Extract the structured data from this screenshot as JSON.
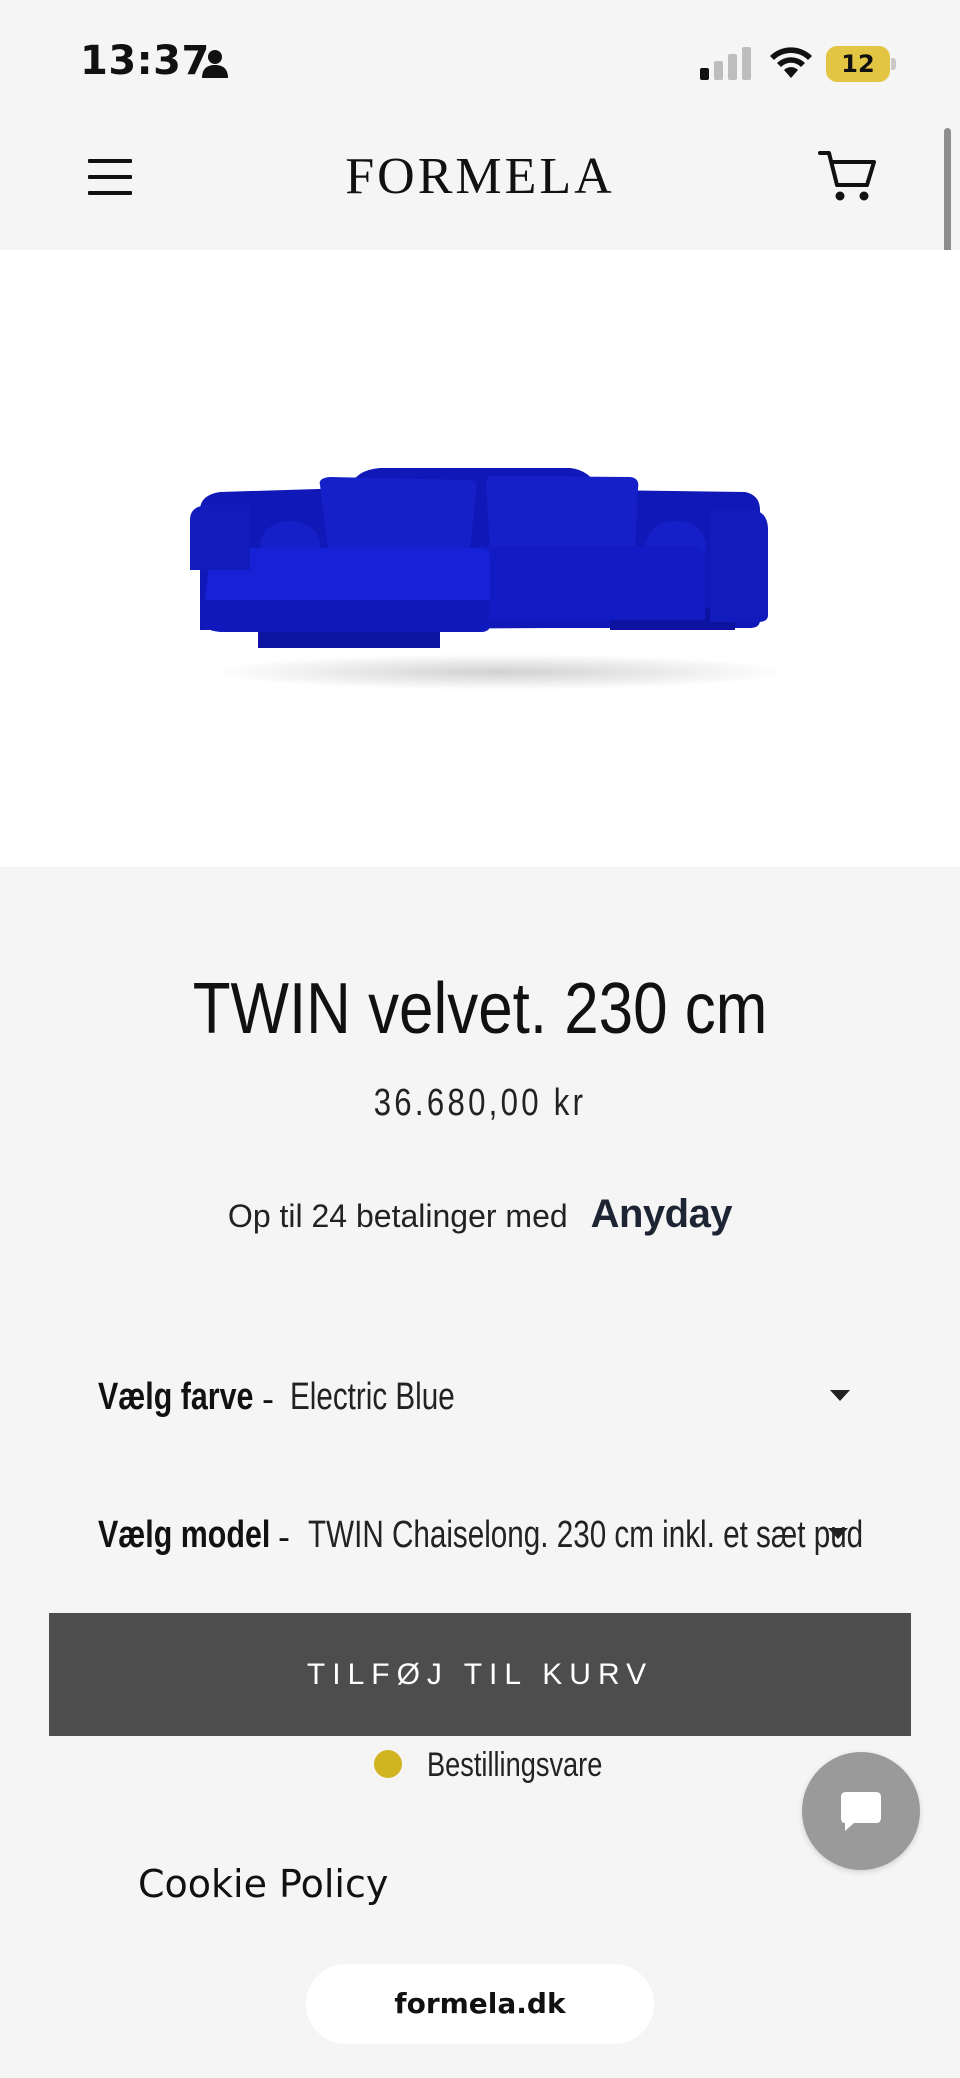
{
  "status_bar": {
    "time": "13:37",
    "battery_level": "12"
  },
  "header": {
    "logo": "FORMELA",
    "icons": [
      "menu-icon",
      "cart-icon"
    ]
  },
  "product": {
    "title": "TWIN velvet. 230 cm",
    "price": "36.680,00 kr",
    "installments_text": "Op til 24 betalinger med",
    "installments_brand": "Anyday",
    "sofa_color": "#1a22c9"
  },
  "options": {
    "color": {
      "label": "Vælg farve",
      "separator": "-",
      "value": "Electric Blue"
    },
    "model": {
      "label": "Vælg model",
      "separator": "-",
      "value": "TWIN Chaiselong. 230 cm inkl. et sæt pud"
    }
  },
  "cart": {
    "add_to_cart_label": "TILFØJ TIL KURV",
    "stock_status": "Bestillingsvare",
    "stock_color": "#d1b520"
  },
  "footer": {
    "cookie_policy": "Cookie Policy",
    "url": "formela.dk"
  }
}
